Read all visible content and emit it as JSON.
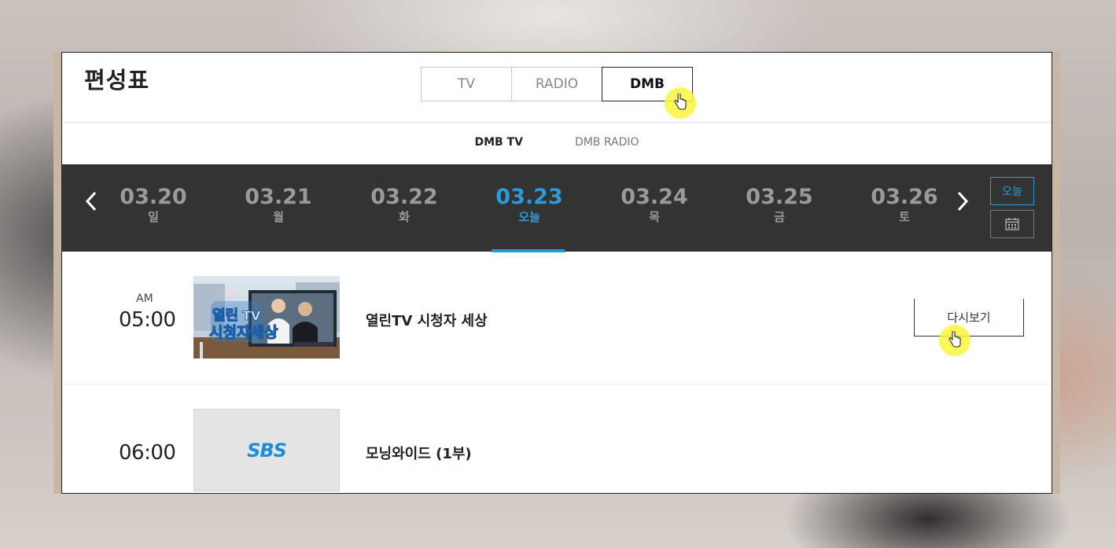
{
  "page": {
    "title": "편성표"
  },
  "media_tabs": [
    {
      "label": "TV",
      "active": false
    },
    {
      "label": "RADIO",
      "active": false
    },
    {
      "label": "DMB",
      "active": true
    }
  ],
  "sub_tabs": [
    {
      "label": "DMB TV",
      "active": true
    },
    {
      "label": "DMB RADIO",
      "active": false
    }
  ],
  "dates": [
    {
      "date": "03.20",
      "weekday": "일",
      "active": false
    },
    {
      "date": "03.21",
      "weekday": "월",
      "active": false
    },
    {
      "date": "03.22",
      "weekday": "화",
      "active": false
    },
    {
      "date": "03.23",
      "weekday": "오늘",
      "active": true
    },
    {
      "date": "03.24",
      "weekday": "목",
      "active": false
    },
    {
      "date": "03.25",
      "weekday": "금",
      "active": false
    },
    {
      "date": "03.26",
      "weekday": "토",
      "active": false
    }
  ],
  "date_controls": {
    "prev_icon": "chevron-left-icon",
    "next_icon": "chevron-right-icon",
    "today_label": "오늘",
    "calendar_icon": "calendar-icon"
  },
  "programs": [
    {
      "ampm": "AM",
      "time": "05:00",
      "title": "열린TV 시청자 세상",
      "thumbnail": "program-thumbnail-image",
      "replay_label": "다시보기"
    },
    {
      "ampm": "",
      "time": "06:00",
      "title": "모닝와이드 (1부)",
      "thumbnail_logo": "SBS"
    }
  ],
  "colors": {
    "accent": "#1e9ad8",
    "datebar_bg": "#333334",
    "cursor_highlight": "#faf53c"
  }
}
